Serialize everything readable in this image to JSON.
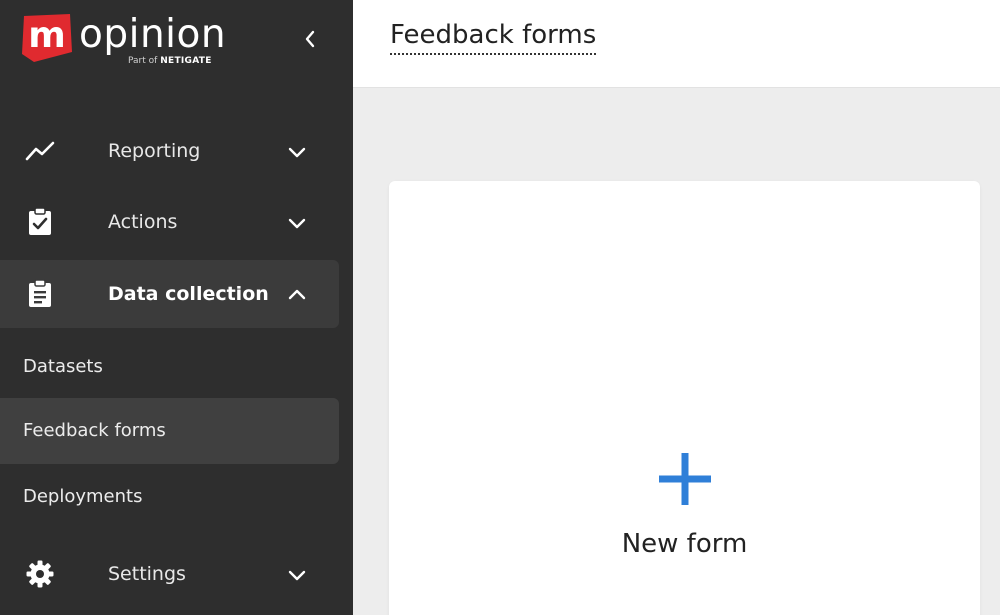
{
  "brand": {
    "name": "opinion",
    "badge_letter": "m",
    "part_of_prefix": "Part of",
    "part_of_brand": "NETIGATE",
    "badge_color": "#e02a2f"
  },
  "sidebar": {
    "background": "#2e2e2e",
    "nav": [
      {
        "label": "Reporting",
        "icon": "trending-up-icon",
        "expanded": false
      },
      {
        "label": "Actions",
        "icon": "clipboard-check-icon",
        "expanded": false
      },
      {
        "label": "Data collection",
        "icon": "clipboard-list-icon",
        "expanded": true
      },
      {
        "label": "Settings",
        "icon": "gear-icon",
        "expanded": false
      }
    ],
    "sub_items": [
      {
        "label": "Datasets",
        "active": false
      },
      {
        "label": "Feedback forms",
        "active": true
      },
      {
        "label": "Deployments",
        "active": false
      }
    ]
  },
  "header": {
    "title": "Feedback forms"
  },
  "main": {
    "new_form_label": "New form",
    "accent_color": "#2f7fd8"
  }
}
